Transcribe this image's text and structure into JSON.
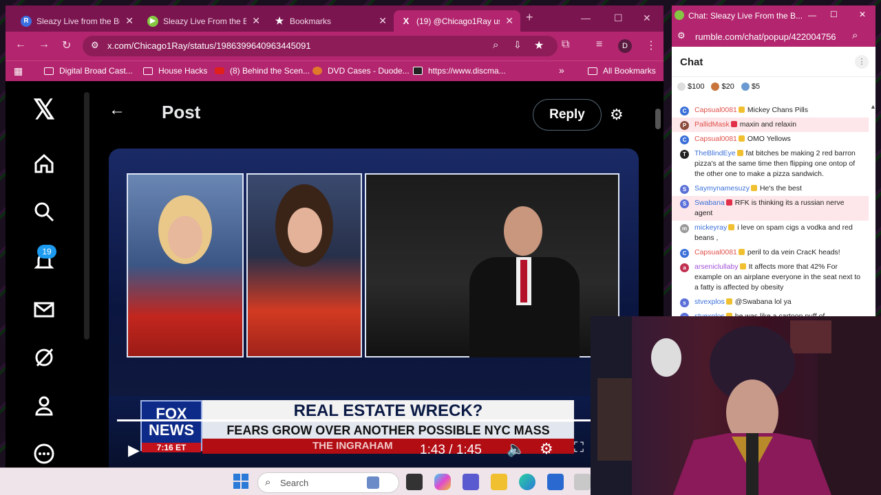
{
  "browser": {
    "tabs": [
      {
        "title": "Sleazy Live from the Bu",
        "icon_letter": "R"
      },
      {
        "title": "Sleazy Live From the Bu",
        "icon_letter": "▶"
      },
      {
        "title": "Bookmarks",
        "icon_letter": "★"
      },
      {
        "title": "(19) @Chicago1Ray us",
        "icon_letter": "X"
      }
    ],
    "new_tab": "+",
    "url": "x.com/Chicago1Ray/status/1986399640963445091",
    "profile": "D",
    "bookmarks": [
      "Digital Broad Cast...",
      "House Hacks",
      "(8) Behind the Scen...",
      "DVD Cases - Duode...",
      "https://www.discma..."
    ],
    "overflow": "»",
    "all_bookmarks": "All Bookmarks"
  },
  "x": {
    "notifications_count": "19",
    "post_title": "Post",
    "reply_label": "Reply",
    "video": {
      "network": "FOX NEWS",
      "network_time": "7:16 ET",
      "headline": "REAL ESTATE WRECK?",
      "subheadline": "FEARS GROW OVER ANOTHER POSSIBLE NYC MASS EXODUS",
      "show": "THE INGRAHAM",
      "timecode": "1:43 / 1:45",
      "progress": 0.98
    }
  },
  "chat": {
    "window_title": "Chat: Sleazy Live From the B...",
    "url": "rumble.com/chat/popup/422004756",
    "title": "Chat",
    "tips": [
      "$100",
      "$20",
      "$5"
    ],
    "messages": [
      {
        "user": "Capsual0081",
        "text": "Mickey Chans Pills",
        "color": "#e0504a",
        "av": "#3a6fd8",
        "letter": "C",
        "highlight": false
      },
      {
        "user": "PallidMask",
        "text": "maxin and relaxin",
        "color": "#e0504a",
        "av": "#8a4a3a",
        "letter": "P",
        "highlight": true
      },
      {
        "user": "Capsual0081",
        "text": "OMO Yellows",
        "color": "#e0504a",
        "av": "#3a6fd8",
        "letter": "C",
        "highlight": false
      },
      {
        "user": "TheBlindEye",
        "text": "fat bitches be making 2 red barron pizza's at the same time then flipping one ontop of the other one to make a pizza sandwich.",
        "color": "#3a6fd8",
        "av": "#222",
        "letter": "T",
        "highlight": false
      },
      {
        "user": "Saymynamesuzy",
        "text": "He's the best",
        "color": "#3a6fd8",
        "av": "#5a6fd8",
        "letter": "S",
        "highlight": false
      },
      {
        "user": "Swabana",
        "text": "RFK is thinking its a russian nerve agent",
        "color": "#3a6fd8",
        "av": "#5a6fd8",
        "letter": "S",
        "highlight": true
      },
      {
        "user": "mickeyray",
        "text": "i leve on spam cigs a vodka and red beans ,",
        "color": "#3a6fd8",
        "av": "#999",
        "letter": "m",
        "highlight": false
      },
      {
        "user": "Capsual0081",
        "text": "peril to da vein CracK heads!",
        "color": "#e0504a",
        "av": "#3a6fd8",
        "letter": "C",
        "highlight": false
      },
      {
        "user": "arseniclullaby",
        "text": "It affects more that 42% For example on an airplane everyone in the seat next to a fatty is affected by obesity",
        "color": "#a050d8",
        "av": "#c03050",
        "letter": "a",
        "highlight": false
      },
      {
        "user": "stvexplos",
        "text": "@Swabana lol ya",
        "color": "#3a6fd8",
        "av": "#5a6fd8",
        "letter": "s",
        "highlight": false
      },
      {
        "user": "stvexplos",
        "text": "he was like a cartoon puff of",
        "color": "#3a6fd8",
        "av": "#5a6fd8",
        "letter": "s",
        "highlight": false
      }
    ]
  },
  "taskbar": {
    "search_label": "Search"
  }
}
